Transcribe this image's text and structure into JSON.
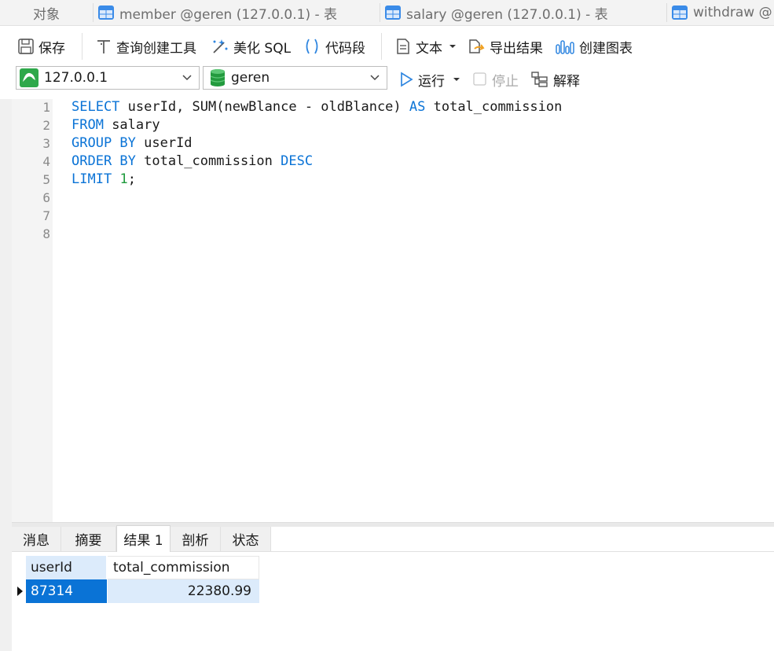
{
  "tabs": [
    {
      "label": "对象",
      "icon": "none"
    },
    {
      "label": "member @geren (127.0.0.1) - 表",
      "icon": "table-icon"
    },
    {
      "label": "salary @geren (127.0.0.1) - 表",
      "icon": "table-icon"
    },
    {
      "label": "withdraw @",
      "icon": "table-icon"
    }
  ],
  "toolbar": {
    "save": "保存",
    "query_builder": "查询创建工具",
    "beautify": "美化 SQL",
    "snippet": "代码段",
    "text": "文本",
    "export": "导出结果",
    "create_chart": "创建图表"
  },
  "connection": {
    "selected": "127.0.0.1"
  },
  "database": {
    "selected": "geren"
  },
  "run": {
    "run_label": "运行",
    "stop_label": "停止",
    "explain_label": "解释"
  },
  "editor": {
    "line_numbers": [
      "1",
      "2",
      "3",
      "4",
      "5",
      "6",
      "7",
      "8"
    ],
    "lines": [
      [
        {
          "t": "SELECT",
          "k": "kw"
        },
        {
          "t": " userId, SUM(newBlance - oldBlance) ",
          "k": ""
        },
        {
          "t": "AS",
          "k": "kw"
        },
        {
          "t": " total_commission",
          "k": ""
        }
      ],
      [
        {
          "t": "FROM",
          "k": "kw"
        },
        {
          "t": " salary",
          "k": ""
        }
      ],
      [
        {
          "t": "GROUP BY",
          "k": "kw"
        },
        {
          "t": " userId",
          "k": ""
        }
      ],
      [
        {
          "t": "ORDER BY",
          "k": "kw"
        },
        {
          "t": " total_commission ",
          "k": ""
        },
        {
          "t": "DESC",
          "k": "kw"
        }
      ],
      [
        {
          "t": "LIMIT",
          "k": "kw"
        },
        {
          "t": " ",
          "k": ""
        },
        {
          "t": "1",
          "k": "num"
        },
        {
          "t": ";",
          "k": ""
        }
      ]
    ]
  },
  "result_tabs": [
    "消息",
    "摘要",
    "结果 1",
    "剖析",
    "状态"
  ],
  "result_active": "结果 1",
  "grid": {
    "columns": [
      "userId",
      "total_commission"
    ],
    "rows": [
      [
        "87314",
        "22380.99"
      ]
    ]
  },
  "colors": {
    "keyword": "#0a73d6",
    "number": "#1e9a3c",
    "selection": "#0a73d6",
    "row_highlight": "#dcebfb"
  }
}
